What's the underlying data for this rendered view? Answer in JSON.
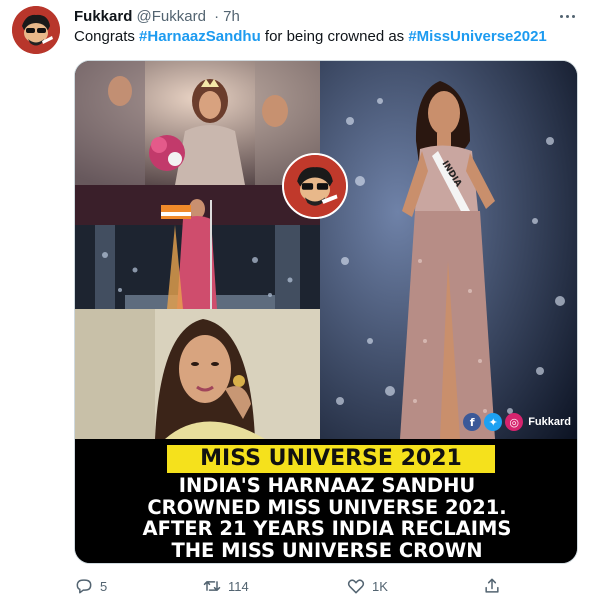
{
  "tweet": {
    "author_name": "Fukkard",
    "handle": "@Fukkard",
    "separator": "·",
    "time": "7h",
    "text_prefix": "Congrats ",
    "hashtag1": "#HarnaazSandhu",
    "text_middle": " for being crowned as ",
    "hashtag2": "#MissUniverse2021"
  },
  "media": {
    "banner": "MISS UNIVERSE 2021",
    "headline_lines": [
      "INDIA'S HARNAAZ SANDHU",
      "CROWNED MISS UNIVERSE 2021.",
      "AFTER 21 YEARS INDIA RECLAIMS",
      "THE MISS UNIVERSE CROWN"
    ],
    "sash_text": "INDIA",
    "watermark": "Fukkard",
    "social_icons": [
      "facebook-icon",
      "twitter-icon",
      "instagram-icon"
    ]
  },
  "actions": {
    "replies": "5",
    "retweets": "114",
    "likes": "1K"
  },
  "colors": {
    "link": "#1d9bf0",
    "muted": "#536471",
    "banner": "#f5e11c",
    "brand": "#c0392b"
  }
}
